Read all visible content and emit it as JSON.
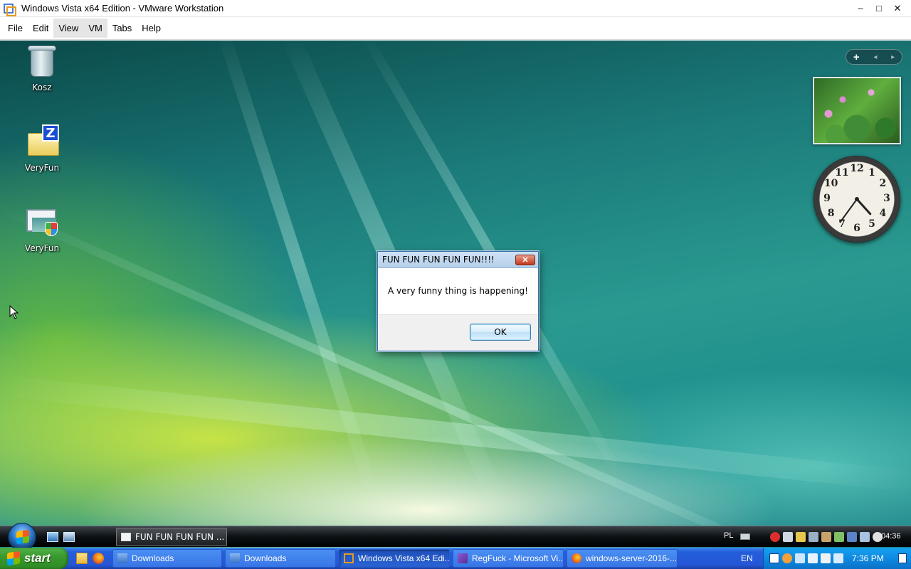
{
  "host": {
    "title": "Windows Vista x64 Edition - VMware Workstation",
    "controls": {
      "minimize": "–",
      "maximize": "□",
      "close": "✕"
    },
    "menu": [
      "File",
      "Edit",
      "View",
      "VM",
      "Tabs",
      "Help"
    ],
    "active_menu_indices": [
      2,
      3
    ]
  },
  "guest": {
    "desktop_icons": [
      {
        "label": "Kosz",
        "icon": "recycle-bin-icon"
      },
      {
        "label": "VeryFun",
        "icon": "zip-folder-icon"
      },
      {
        "label": "VeryFun",
        "icon": "installer-icon"
      }
    ],
    "sidebar": {
      "add_gadget": "+",
      "prev": "◂",
      "next": "▸",
      "clock": {
        "hour": 4,
        "minute": 36,
        "numbers": [
          "12",
          "1",
          "2",
          "3",
          "4",
          "5",
          "6",
          "7",
          "8",
          "9",
          "10",
          "11"
        ]
      }
    },
    "dialog": {
      "title": "FUN FUN FUN FUN FUN!!!!",
      "close": "✕",
      "message": "A very funny thing is happening!",
      "ok": "OK"
    },
    "taskbar": {
      "task": "FUN FUN FUN FUN ...",
      "language": "PL",
      "time": "04:36"
    }
  },
  "host_taskbar": {
    "start": "start",
    "tasks": [
      {
        "label": "Downloads",
        "icon": "folder-icon",
        "active": false
      },
      {
        "label": "Downloads",
        "icon": "folder-icon",
        "active": false
      },
      {
        "label": "Windows Vista x64 Edi...",
        "icon": "vmware-icon",
        "active": true
      },
      {
        "label": "RegFuck - Microsoft Vi...",
        "icon": "visual-studio-icon",
        "active": false
      },
      {
        "label": "windows-server-2016-...",
        "icon": "firefox-icon",
        "active": false
      }
    ],
    "language": "EN",
    "time": "7:36 PM"
  },
  "colors": {
    "dialog_border": "#3a6ea5",
    "host_taskbar": "#245edb",
    "start_button": "#3a9a2e"
  }
}
